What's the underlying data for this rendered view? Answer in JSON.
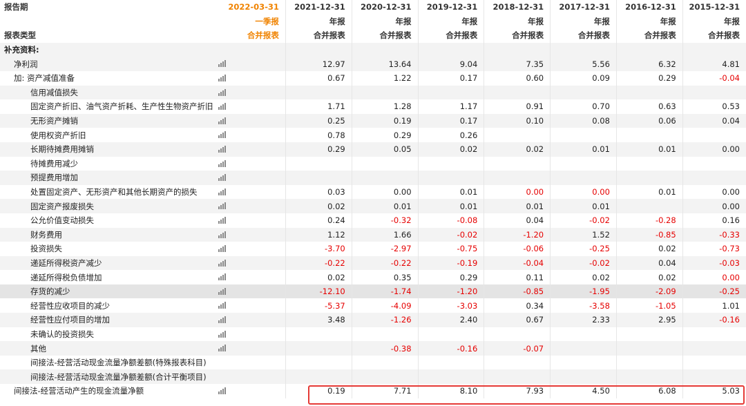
{
  "header": {
    "period_label": "报告期",
    "type_label": "报表类型",
    "dates": [
      "2022-03-31",
      "2021-12-31",
      "2020-12-31",
      "2019-12-31",
      "2018-12-31",
      "2017-12-31",
      "2016-12-31",
      "2015-12-31"
    ],
    "report_kinds": [
      "一季报",
      "年报",
      "年报",
      "年报",
      "年报",
      "年报",
      "年报",
      "年报"
    ],
    "statement_types": [
      "合并报表",
      "合并报表",
      "合并报表",
      "合并报表",
      "合并报表",
      "合并报表",
      "合并报表",
      "合并报表"
    ]
  },
  "section_title": "补充资料:",
  "rows": [
    {
      "label": "净利润",
      "indent": 1,
      "values": [
        "",
        "12.97",
        "13.64",
        "9.04",
        "7.35",
        "5.56",
        "6.32",
        "4.81"
      ]
    },
    {
      "label": "加: 资产减值准备",
      "indent": 1,
      "values": [
        "",
        "0.67",
        "1.22",
        "0.17",
        "0.60",
        "0.09",
        "0.29",
        "-0.04"
      ]
    },
    {
      "label": "信用减值损失",
      "indent": 2,
      "values": [
        "",
        "",
        "",
        "",
        "",
        "",
        "",
        ""
      ]
    },
    {
      "label": "固定资产折旧、油气资产折耗、生产性生物资产折旧",
      "indent": 2,
      "values": [
        "",
        "1.71",
        "1.28",
        "1.17",
        "0.91",
        "0.70",
        "0.63",
        "0.53"
      ]
    },
    {
      "label": "无形资产摊销",
      "indent": 2,
      "values": [
        "",
        "0.25",
        "0.19",
        "0.17",
        "0.10",
        "0.08",
        "0.06",
        "0.04"
      ]
    },
    {
      "label": "使用权资产折旧",
      "indent": 2,
      "values": [
        "",
        "0.78",
        "0.29",
        "0.26",
        "",
        "",
        "",
        ""
      ]
    },
    {
      "label": "长期待摊费用摊销",
      "indent": 2,
      "values": [
        "",
        "0.29",
        "0.05",
        "0.02",
        "0.02",
        "0.01",
        "0.01",
        "0.00"
      ]
    },
    {
      "label": "待摊费用减少",
      "indent": 2,
      "values": [
        "",
        "",
        "",
        "",
        "",
        "",
        "",
        ""
      ]
    },
    {
      "label": "预提费用增加",
      "indent": 2,
      "values": [
        "",
        "",
        "",
        "",
        "",
        "",
        "",
        ""
      ]
    },
    {
      "label": "处置固定资产、无形资产和其他长期资产的损失",
      "indent": 2,
      "values": [
        "",
        "0.03",
        "0.00",
        "0.01",
        "0.00",
        "0.00",
        "0.01",
        "0.00"
      ],
      "red": [
        4,
        5
      ]
    },
    {
      "label": "固定资产报废损失",
      "indent": 2,
      "values": [
        "",
        "0.02",
        "0.01",
        "0.01",
        "0.01",
        "0.01",
        "",
        "0.00"
      ]
    },
    {
      "label": "公允价值变动损失",
      "indent": 2,
      "values": [
        "",
        "0.24",
        "-0.32",
        "-0.08",
        "0.04",
        "-0.02",
        "-0.28",
        "0.16"
      ]
    },
    {
      "label": "财务费用",
      "indent": 2,
      "values": [
        "",
        "1.12",
        "1.66",
        "-0.02",
        "-1.20",
        "1.52",
        "-0.85",
        "-0.33"
      ]
    },
    {
      "label": "投资损失",
      "indent": 2,
      "values": [
        "",
        "-3.70",
        "-2.97",
        "-0.75",
        "-0.06",
        "-0.25",
        "0.02",
        "-0.73"
      ]
    },
    {
      "label": "递延所得税资产减少",
      "indent": 2,
      "values": [
        "",
        "-0.22",
        "-0.22",
        "-0.19",
        "-0.04",
        "-0.02",
        "0.04",
        "-0.03"
      ]
    },
    {
      "label": "递延所得税负债增加",
      "indent": 2,
      "values": [
        "",
        "0.02",
        "0.35",
        "0.29",
        "0.11",
        "0.02",
        "0.02",
        "0.00"
      ],
      "red": [
        7
      ]
    },
    {
      "label": "存货的减少",
      "indent": 2,
      "values": [
        "",
        "-12.10",
        "-1.74",
        "-1.20",
        "-0.85",
        "-1.95",
        "-2.09",
        "-0.25"
      ],
      "highlight": true
    },
    {
      "label": "经营性应收项目的减少",
      "indent": 2,
      "values": [
        "",
        "-5.37",
        "-4.09",
        "-3.03",
        "0.34",
        "-3.58",
        "-1.05",
        "1.01"
      ]
    },
    {
      "label": "经营性应付项目的增加",
      "indent": 2,
      "values": [
        "",
        "3.48",
        "-1.26",
        "2.40",
        "0.67",
        "2.33",
        "2.95",
        "-0.16"
      ]
    },
    {
      "label": "未确认的投资损失",
      "indent": 2,
      "values": [
        "",
        "",
        "",
        "",
        "",
        "",
        "",
        ""
      ]
    },
    {
      "label": "其他",
      "indent": 2,
      "values": [
        "",
        "",
        "-0.38",
        "-0.16",
        "-0.07",
        "",
        "",
        ""
      ]
    },
    {
      "label": "间接法-经营活动现金流量净额差额(特殊报表科目)",
      "indent": 2,
      "no_icon": true,
      "values": [
        "",
        "",
        "",
        "",
        "",
        "",
        "",
        ""
      ]
    },
    {
      "label": "间接法-经营活动现金流量净额差额(合计平衡项目)",
      "indent": 2,
      "no_icon": true,
      "values": [
        "",
        "",
        "",
        "",
        "",
        "",
        "",
        ""
      ]
    },
    {
      "label": "间接法-经营活动产生的现金流量净额",
      "indent": 1,
      "values": [
        "",
        "0.19",
        "7.71",
        "8.10",
        "7.93",
        "4.50",
        "6.08",
        "5.03"
      ]
    }
  ],
  "colors": {
    "accent": "#f08300",
    "negative": "#e60000",
    "highlight_box": "#e53935"
  }
}
